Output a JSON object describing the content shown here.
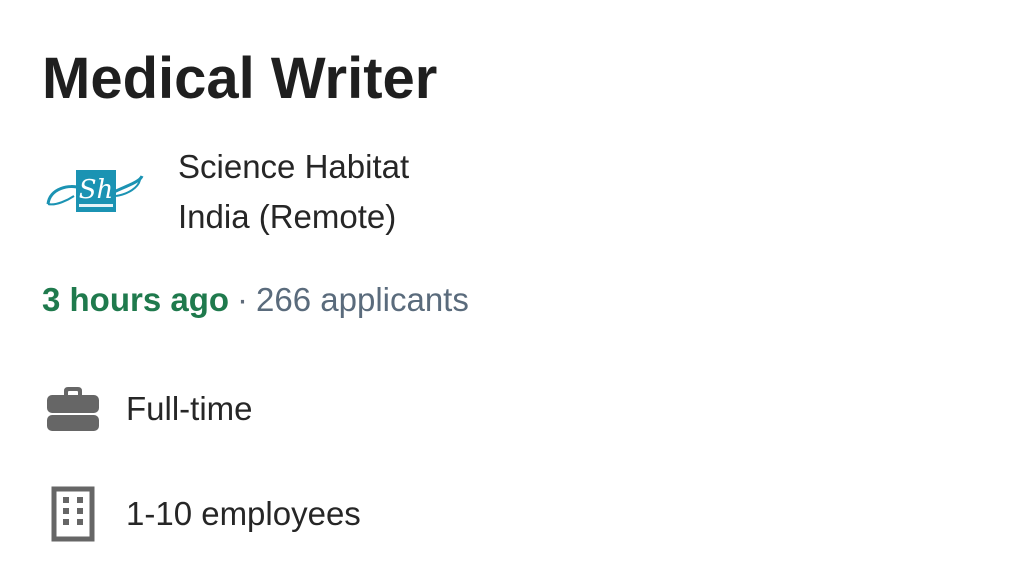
{
  "job": {
    "title": "Medical Writer",
    "company": "Science Habitat",
    "location": "India (Remote)",
    "posted": "3 hours ago",
    "separator": "·",
    "applicants": "266 applicants"
  },
  "insights": [
    {
      "icon": "briefcase-icon",
      "label": "Full-time"
    },
    {
      "icon": "building-icon",
      "label": "1-10 employees"
    }
  ],
  "logo": {
    "monogram": "Sh",
    "color": "#1b93b3"
  },
  "colors": {
    "posted": "#1f7a4d",
    "applicants": "#5a6b7c",
    "icon": "#666666"
  }
}
